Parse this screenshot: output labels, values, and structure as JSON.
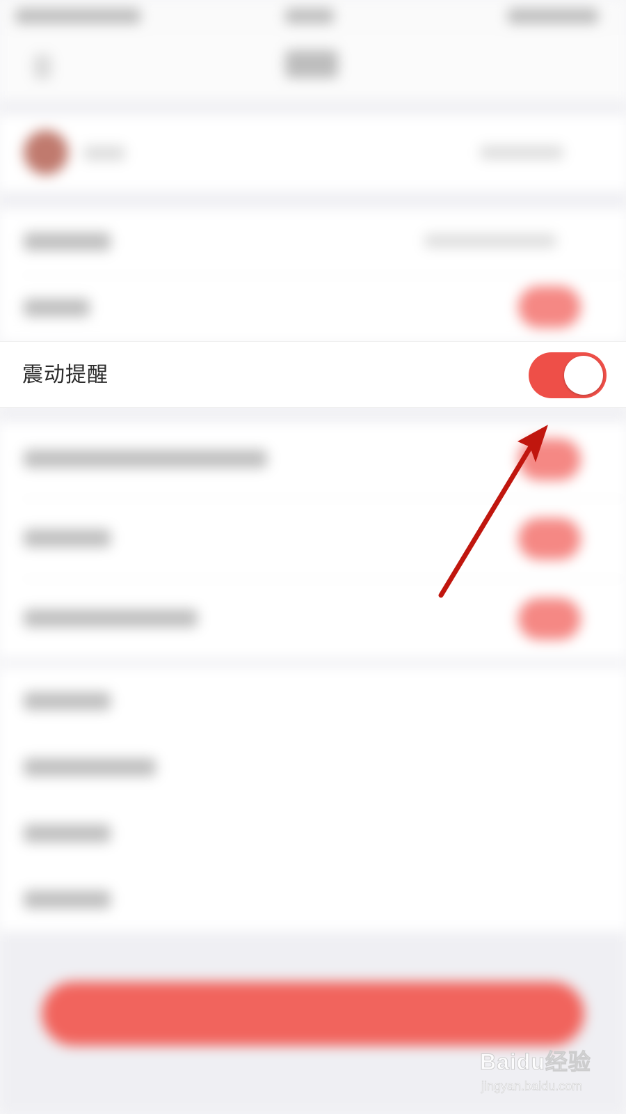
{
  "settings": {
    "vibration_label": "震动提醒",
    "vibration_enabled": true
  },
  "colors": {
    "accent": "#ee4f48",
    "annotation_arrow": "#c0160e",
    "background": "#f6f6f8"
  },
  "annotation": {
    "type": "arrow",
    "points_to": "vibration-toggle"
  },
  "watermark": {
    "title": "Baidu经验",
    "subtitle": "jingyan.baidu.com"
  }
}
